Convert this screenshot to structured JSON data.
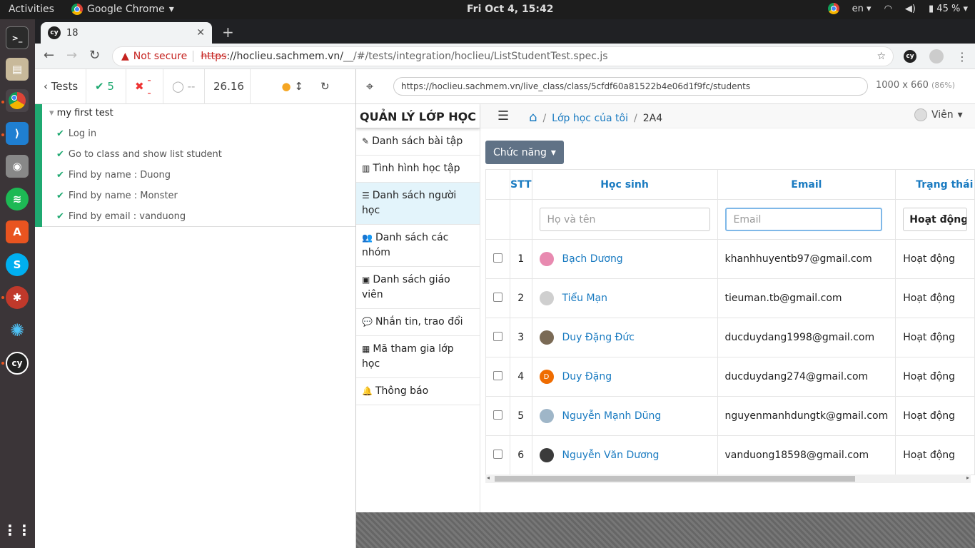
{
  "topbar": {
    "activities": "Activities",
    "app_name": "Google Chrome",
    "clock": "Fri Oct  4, 15:42",
    "lang": "en",
    "battery": "45 %"
  },
  "dock": {
    "items": [
      "terminal-icon",
      "files-icon",
      "chrome-icon",
      "vscode-icon",
      "camera-icon",
      "spotify-icon",
      "software-icon",
      "skype-icon",
      "settings-icon",
      "network-icon",
      "cypress-icon",
      "apps-grid-icon"
    ]
  },
  "tab": {
    "title": "18"
  },
  "omnibox": {
    "not_secure": "Not secure",
    "proto": "https",
    "host": "://hoclieu.sachmem.vn/",
    "path": "__/#/tests/integration/hoclieu/ListStudentTest.spec.js"
  },
  "runner": {
    "tests_label": "Tests",
    "passed": "5",
    "failed": "--",
    "pending": "--",
    "duration": "26.16",
    "suite": "my first test",
    "tests": [
      "Log in",
      "Go to class and show list student",
      "Find by name : Duong",
      "Find by name : Monster",
      "Find by email : vanduong"
    ]
  },
  "aut": {
    "url": "https://hoclieu.sachmem.vn/live_class/class/5cfdf60a81522b4e06d1f9fc/students",
    "size": "1000 x 660",
    "scale": "(86%)"
  },
  "app": {
    "brand": "QUẢN LÝ LỚP HỌC",
    "menu": [
      {
        "icon": "edit-icon",
        "glyph": "✎",
        "label": "Danh sách bài tập"
      },
      {
        "icon": "chart-icon",
        "glyph": "▥",
        "label": "Tình hình học tập"
      },
      {
        "icon": "list-icon",
        "glyph": "☰",
        "label": "Danh sách người học"
      },
      {
        "icon": "users-icon",
        "glyph": "👥",
        "label": "Danh sách các nhóm"
      },
      {
        "icon": "teacher-icon",
        "glyph": "▣",
        "label": "Danh sách giáo viên"
      },
      {
        "icon": "chat-icon",
        "glyph": "💬",
        "label": "Nhắn tin, trao đổi"
      },
      {
        "icon": "qrcode-icon",
        "glyph": "▦",
        "label": "Mã tham gia lớp học"
      },
      {
        "icon": "bell-icon",
        "glyph": "🔔",
        "label": "Thông báo"
      }
    ],
    "breadcrumb": {
      "home": "⌂",
      "sep": "/",
      "my_classes": "Lớp học của tôi",
      "current": "2A4"
    },
    "user": "Viên",
    "function_button": "Chức năng",
    "table": {
      "headers": [
        "STT",
        "Học sinh",
        "Email",
        "Trạng thái"
      ],
      "name_placeholder": "Họ và tên",
      "email_placeholder": "Email",
      "status_filter": "Hoạt động",
      "rows": [
        {
          "stt": "1",
          "name": "Bạch Dương",
          "email": "khanhhuyentb97@gmail.com",
          "status": "Hoạt động",
          "avatar_color": "#e88ab0"
        },
        {
          "stt": "2",
          "name": "Tiểu Mạn",
          "email": "tieuman.tb@gmail.com",
          "status": "Hoạt động",
          "avatar_color": "#cfcfcf"
        },
        {
          "stt": "3",
          "name": "Duy Đặng Đức",
          "email": "ducduydang1998@gmail.com",
          "status": "Hoạt động",
          "avatar_color": "#7a6a55"
        },
        {
          "stt": "4",
          "name": "Duy Đặng",
          "email": "ducduydang274@gmail.com",
          "status": "Hoạt động",
          "avatar_color": "#ef6c00",
          "initial": "D"
        },
        {
          "stt": "5",
          "name": "Nguyễn Mạnh Dũng",
          "email": "nguyenmanhdungtk@gmail.com",
          "status": "Hoạt động",
          "avatar_color": "#9fb6c8"
        },
        {
          "stt": "6",
          "name": "Nguyễn Văn Dương",
          "email": "vanduong18598@gmail.com",
          "status": "Hoạt động",
          "avatar_color": "#3b3b3b"
        }
      ]
    }
  }
}
